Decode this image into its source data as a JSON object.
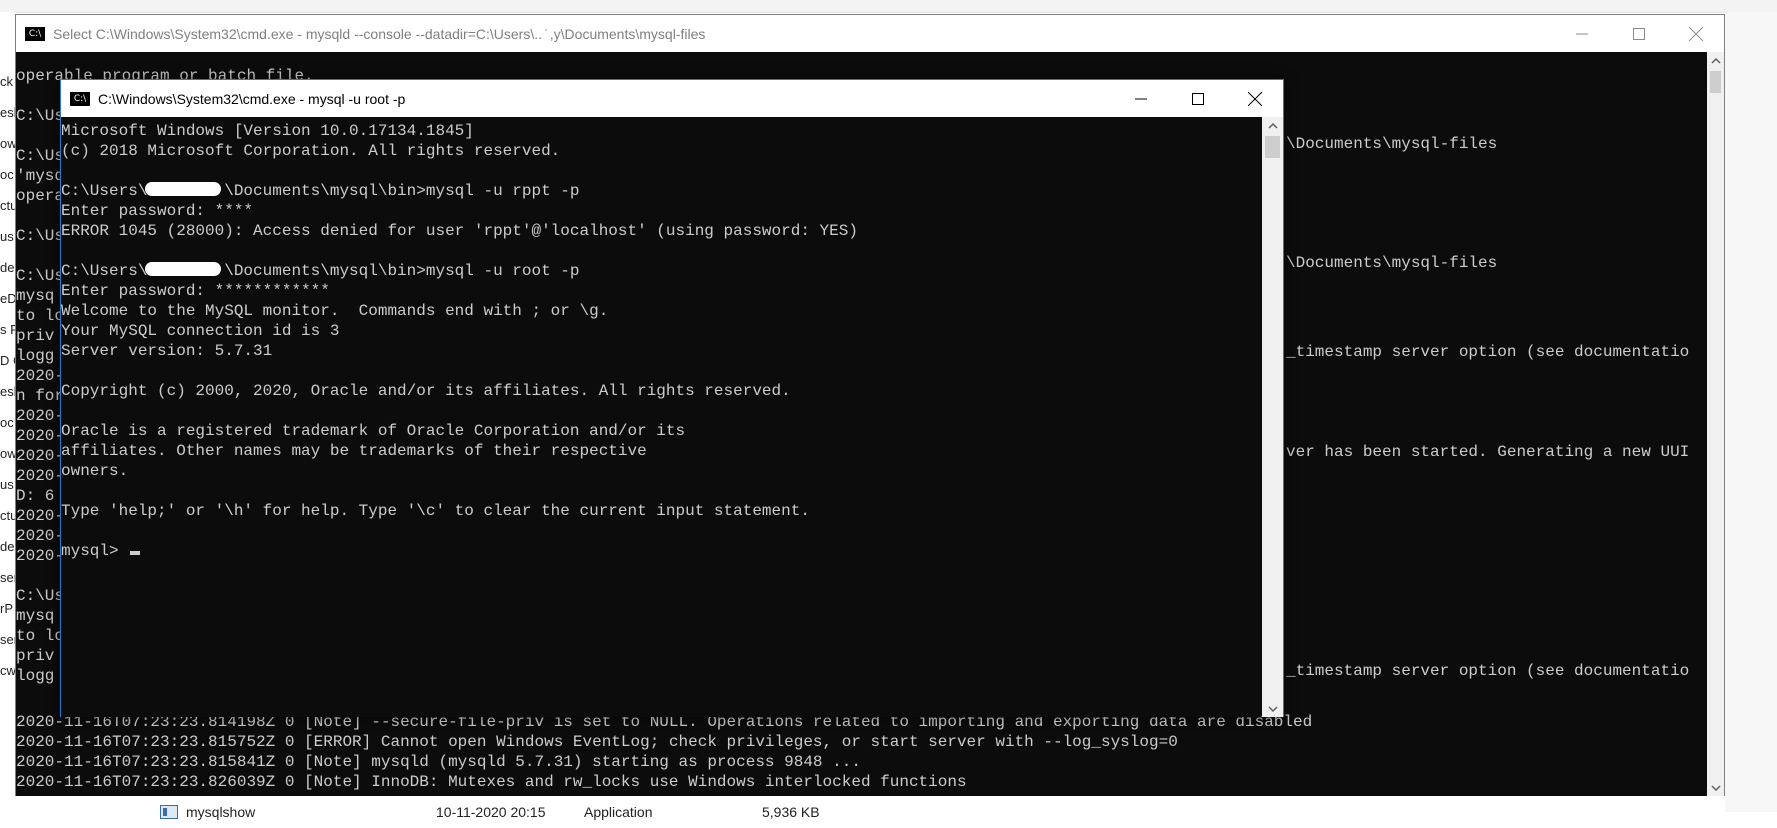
{
  "explorer": {
    "side_fragments": [
      "ck",
      "esk",
      "ow",
      "oc",
      "ctu",
      "us",
      "de",
      "eD",
      "s P",
      "D C",
      "esk",
      "oc",
      "ow",
      "us",
      "ctu",
      "de",
      "ser",
      "rP",
      "ser",
      "cw"
    ],
    "file_row": {
      "name": "mysqlshow",
      "date": "10-11-2020 20:15",
      "type": "Application",
      "size": "5,936 KB"
    }
  },
  "back_window": {
    "title": "Select C:\\Windows\\System32\\cmd.exe - mysqld  --console --datadir=C:\\Users\\.. ̇ ,y\\Documents\\mysql-files",
    "left_lines": [
      "operable program or batch file.",
      "",
      "C:\\Us",
      "",
      "C:\\Us",
      "'mysq",
      "opera",
      "",
      "C:\\Us",
      "",
      "C:\\Us",
      "mysq",
      "to lo",
      "priv",
      "logg",
      "2020-",
      "n for",
      "2020-",
      "2020-",
      "2020-",
      "2020-",
      "D: 6",
      "2020-",
      "2020-",
      "2020-",
      "",
      "C:\\Us",
      "mysq",
      "to lo",
      "priv",
      "logg",
      "2020-",
      "n for"
    ],
    "right_fragments": [
      "\\Documents\\mysql-files",
      "\\Documents\\mysql-files",
      "_timestamp server option (see documentatio",
      "ver has been started. Generating a new UUI",
      "_timestamp server option (see documentatio"
    ],
    "bottom_lines": [
      "2020-11-16T07:23:23.814198Z 0 [Note] --secure-file-priv is set to NULL. Operations related to importing and exporting data are disabled",
      "2020-11-16T07:23:23.815752Z 0 [ERROR] Cannot open Windows EventLog; check privileges, or start server with --log_syslog=0",
      "2020-11-16T07:23:23.815841Z 0 [Note] mysqld (mysqld 5.7.31) starting as process 9848 ...",
      "2020-11-16T07:23:23.826039Z 0 [Note] InnoDB: Mutexes and rw_locks use Windows interlocked functions"
    ]
  },
  "front_window": {
    "title": "C:\\Windows\\System32\\cmd.exe - mysql  -u root -p",
    "lines": [
      "Microsoft Windows [Version 10.0.17134.1845]",
      "(c) 2018 Microsoft Corporation. All rights reserved.",
      "",
      "C:\\Users\\        \\Documents\\mysql\\bin>mysql -u rppt -p",
      "Enter password: ****",
      "ERROR 1045 (28000): Access denied for user 'rppt'@'localhost' (using password: YES)",
      "",
      "C:\\Users\\        \\Documents\\mysql\\bin>mysql -u root -p",
      "Enter password: ************",
      "Welcome to the MySQL monitor.  Commands end with ; or \\g.",
      "Your MySQL connection id is 3",
      "Server version: 5.7.31",
      "",
      "Copyright (c) 2000, 2020, Oracle and/or its affiliates. All rights reserved.",
      "",
      "Oracle is a registered trademark of Oracle Corporation and/or its",
      "affiliates. Other names may be trademarks of their respective",
      "owners.",
      "",
      "Type 'help;' or '\\h' for help. Type '\\c' to clear the current input statement.",
      ""
    ],
    "prompt": "mysql> "
  },
  "icons": {
    "cmd_icon": "C:\\",
    "minimize": "minimize-icon",
    "maximize": "maximize-icon",
    "close": "close-icon",
    "scroll_up": "chevron-up-icon",
    "scroll_down": "chevron-down-icon"
  },
  "colors": {
    "console_bg": "#0c0c0c",
    "console_fg": "#cccccc",
    "active_border": "#2b79d0"
  }
}
